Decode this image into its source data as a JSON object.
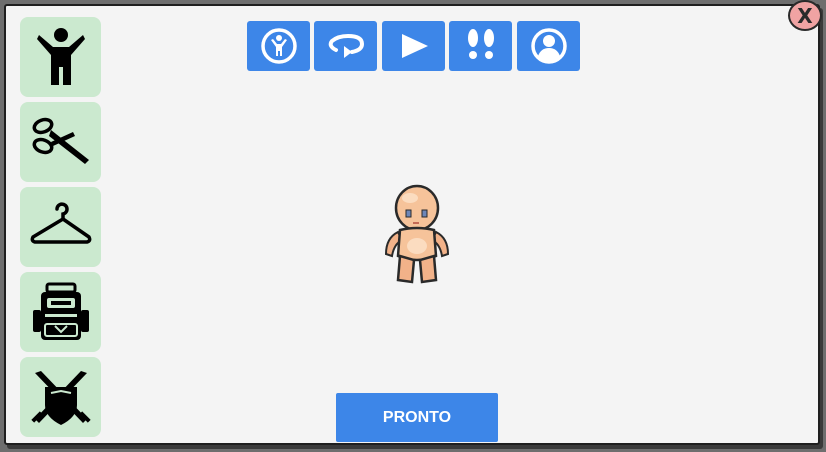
{
  "close_button": {
    "label": "X"
  },
  "sidebar": {
    "items": [
      {
        "icon": "body-icon"
      },
      {
        "icon": "scissors-icon"
      },
      {
        "icon": "hanger-icon"
      },
      {
        "icon": "backpack-icon"
      },
      {
        "icon": "crossed-swords-shield-icon"
      }
    ]
  },
  "toolbar": {
    "items": [
      {
        "icon": "person-circle-icon"
      },
      {
        "icon": "rotate-icon"
      },
      {
        "icon": "play-icon"
      },
      {
        "icon": "footprints-icon"
      },
      {
        "icon": "user-profile-icon"
      }
    ]
  },
  "ready_button": {
    "label": "PRONTO"
  },
  "colors": {
    "accent": "#3d86e8",
    "sidebar_bg": "#cbe9cf",
    "panel_bg": "#f4f4f4",
    "close_bg": "#f0a3a3"
  }
}
